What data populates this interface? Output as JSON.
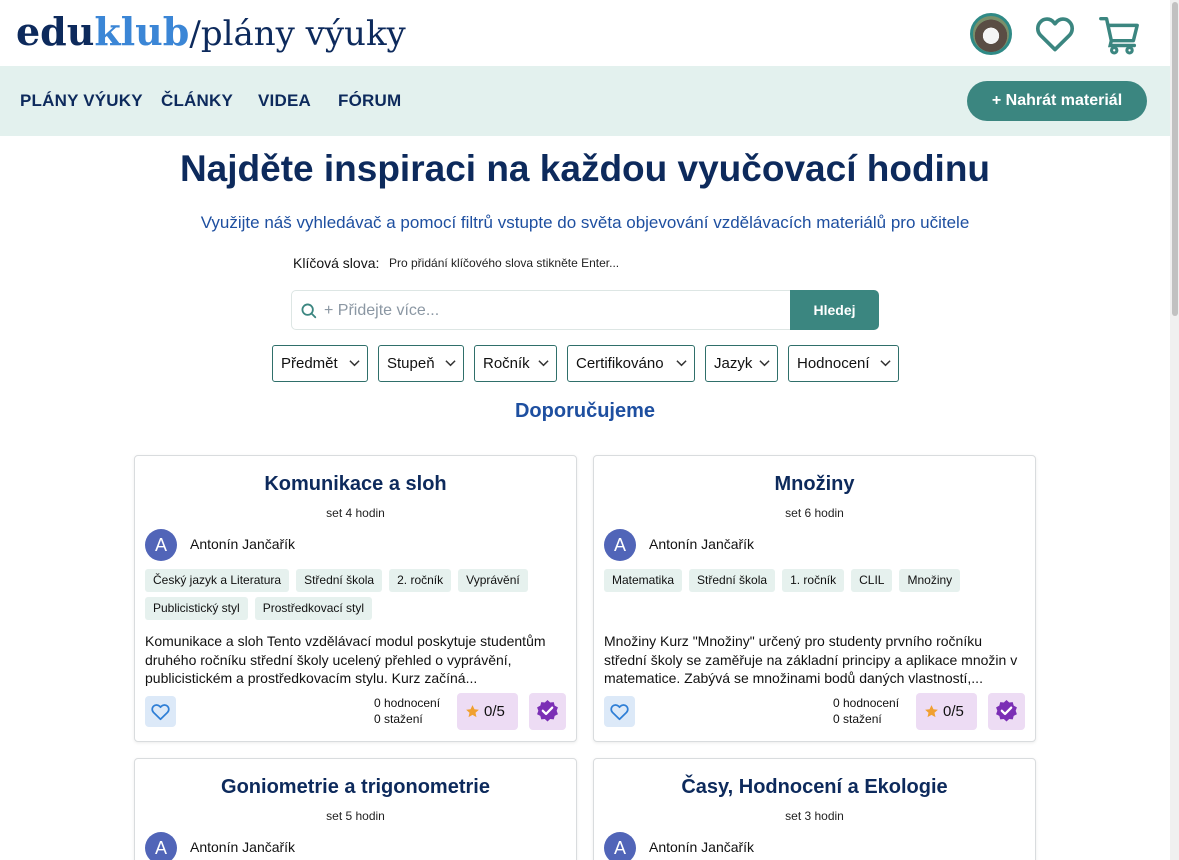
{
  "brand": {
    "edu": "edu",
    "klub": "klub",
    "slash": "/",
    "subtitle": "plány výuky"
  },
  "header_icons": [
    "user-avatar",
    "heart-icon",
    "cart-icon"
  ],
  "nav": {
    "items": [
      "PLÁNY VÝUKY",
      "ČLÁNKY",
      "VIDEA",
      "FÓRUM"
    ],
    "upload_label": "+ Nahrát materiál"
  },
  "hero": {
    "title": "Najděte inspiraci na každou vyučovací hodinu",
    "subtitle": "Využijte náš vyhledávač a pomocí filtrů vstupte do světa objevování vzdělávacích materiálů pro učitele"
  },
  "search": {
    "keywords_label": "Klíčová slova:",
    "keywords_hint": "Pro přidání klíčového slova stikněte Enter...",
    "placeholder": "+ Přidejte více...",
    "button_label": "Hledej"
  },
  "filters": [
    "Předmět",
    "Stupeň",
    "Ročník",
    "Certifikováno",
    "Jazyk",
    "Hodnocení"
  ],
  "recommended_title": "Doporučujeme",
  "colors": {
    "primary": "#3b8680",
    "navy": "#0d2a5c",
    "nav_bg": "#e3f1ee",
    "tag_bg": "#e6f1ee",
    "badge_bg": "#eddcf4",
    "cert": "#7b2fb5",
    "star": "#f0a030"
  },
  "cards": [
    {
      "title": "Komunikace a sloh",
      "subtitle": "set 4 hodin",
      "avatar_letter": "A",
      "author": "Antonín Jančařík",
      "tags": [
        "Český jazyk a Literatura",
        "Střední škola",
        "2. ročník",
        "Vyprávění",
        "Publicistický styl",
        "Prostředkovací styl"
      ],
      "description": "Komunikace a sloh Tento vzdělávací modul poskytuje studentům druhého ročníku střední školy ucelený přehled o vyprávění, publicistickém a prostředkovacím stylu. Kurz začíná...",
      "ratings": "0 hodnocení",
      "downloads": "0 stažení",
      "score": "0/5"
    },
    {
      "title": "Množiny",
      "subtitle": "set 6 hodin",
      "avatar_letter": "A",
      "author": "Antonín Jančařík",
      "tags": [
        "Matematika",
        "Střední škola",
        "1. ročník",
        "CLIL",
        "Množiny"
      ],
      "description": "Množiny Kurz \"Množiny\" určený pro studenty prvního ročníku střední školy se zaměřuje na základní principy a aplikace množin v matematice. Zabývá se množinami bodů daných vlastností,...",
      "ratings": "0 hodnocení",
      "downloads": "0 stažení",
      "score": "0/5"
    },
    {
      "title": "Goniometrie a trigonometrie",
      "subtitle": "set 5 hodin",
      "avatar_letter": "A",
      "author": "Antonín Jančařík"
    },
    {
      "title": "Časy, Hodnocení a Ekologie",
      "subtitle": "set 3 hodin",
      "avatar_letter": "A",
      "author": "Antonín Jančařík"
    }
  ]
}
